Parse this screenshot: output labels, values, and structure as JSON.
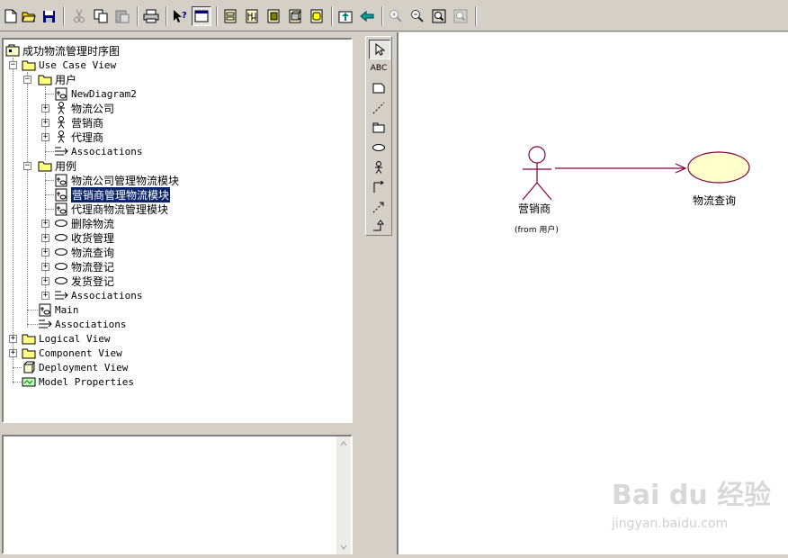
{
  "toolbar": {
    "buttons": [
      "new-file",
      "open-folder",
      "save",
      "cut",
      "copy",
      "paste",
      "print",
      "context-help",
      "view-doc",
      "browse-class-diagram",
      "browse-interaction-diagram",
      "browse-component-diagram",
      "browse-deployment-diagram",
      "browse-state-diagram",
      "browse-parent",
      "browse-previous",
      "zoom-in",
      "zoom-out",
      "fit-in-window",
      "undo-fit"
    ]
  },
  "tree": {
    "root": "成功物流管理时序图",
    "use_case_view": "Use Case View",
    "user_pkg": "用户",
    "new_diagram2": "NewDiagram2",
    "actor_logistics_company": "物流公司",
    "actor_marketer": "营销商",
    "actor_agent": "代理商",
    "associations": "Associations",
    "usecase_pkg": "用例",
    "diag_logistics_module": "物流公司管理物流模块",
    "diag_marketer_module": "营销商管理物流模块",
    "diag_agent_module": "代理商物流管理模块",
    "uc_delete": "删除物流",
    "uc_receive": "收货管理",
    "uc_query": "物流查询",
    "uc_register": "物流登记",
    "uc_ship": "发货登记",
    "main": "Main",
    "logical_view": "Logical View",
    "component_view": "Component View",
    "deployment_view": "Deployment View",
    "model_properties": "Model Properties"
  },
  "diagram_tools": [
    "selection-arrow",
    "text-box",
    "note",
    "anchor-note",
    "package",
    "use-case",
    "actor",
    "unidirectional-association",
    "dependency",
    "generalization"
  ],
  "diagram": {
    "actor_name": "营销商",
    "actor_from": "(from 用户)",
    "usecase_name": "物流查询",
    "usecase_fill": "#ffffcc",
    "association_color": "#800040"
  },
  "tools_text": {
    "abc": "ABC"
  },
  "watermark": {
    "brand": "Bai du 经验",
    "url": "jingyan.baidu.com"
  }
}
